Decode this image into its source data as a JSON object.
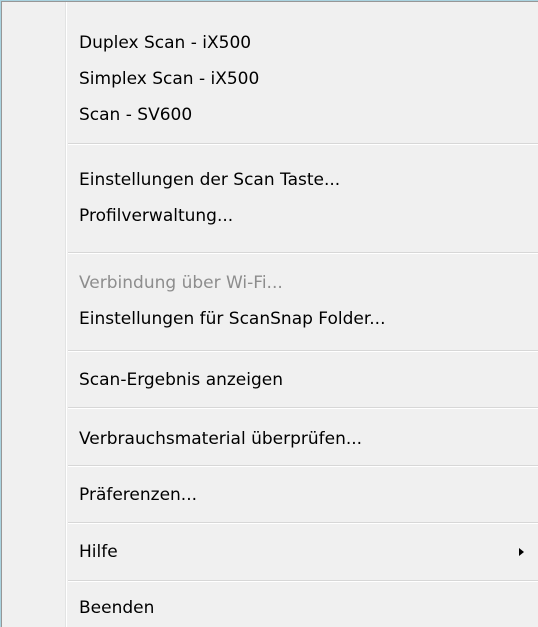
{
  "menu": {
    "items": [
      {
        "label": "Duplex Scan - iX500"
      },
      {
        "label": "Simplex Scan - iX500"
      },
      {
        "label": "Scan - SV600"
      },
      {
        "label": "Einstellungen der Scan Taste..."
      },
      {
        "label": "Profilverwaltung..."
      },
      {
        "label": "Verbindung über Wi-Fi...",
        "disabled": true
      },
      {
        "label": "Einstellungen für ScanSnap Folder..."
      },
      {
        "label": "Scan-Ergebnis anzeigen"
      },
      {
        "label": "Verbrauchsmaterial überprüfen..."
      },
      {
        "label": "Präferenzen..."
      },
      {
        "label": "Hilfe",
        "submenu": true,
        "icon": "chevron-right-icon"
      },
      {
        "label": "Beenden"
      }
    ]
  }
}
